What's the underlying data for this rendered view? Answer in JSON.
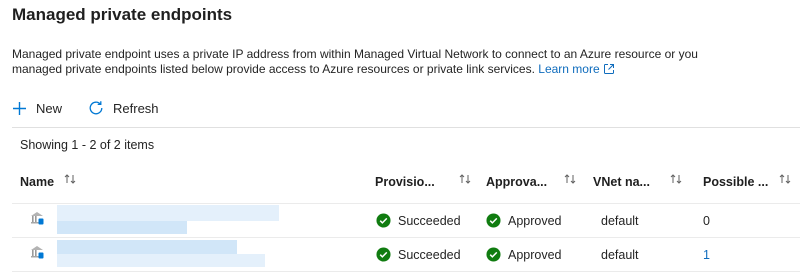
{
  "page": {
    "title": "Managed private endpoints",
    "description_line1": "Managed private endpoint uses a private IP address from within Managed Virtual Network to connect to an Azure resource or you",
    "description_line2": "managed private endpoints listed below provide access to Azure resources or private link services.",
    "learn_more": "Learn more"
  },
  "toolbar": {
    "new_label": "New",
    "refresh_label": "Refresh"
  },
  "list": {
    "count_text": "Showing 1 - 2 of 2 items",
    "columns": [
      {
        "label": "Name"
      },
      {
        "label": "Provisio..."
      },
      {
        "label": "Approva..."
      },
      {
        "label": "VNet na..."
      },
      {
        "label": "Possible ..."
      }
    ],
    "rows": [
      {
        "provisioning": "Succeeded",
        "approval": "Approved",
        "vnet": "default",
        "possible": "0"
      },
      {
        "provisioning": "Succeeded",
        "approval": "Approved",
        "vnet": "default",
        "possible": "1"
      }
    ]
  },
  "colors": {
    "link": "#0f6cbd",
    "success": "#107c10",
    "accent": "#0078d4"
  },
  "icons": {
    "new": "plus-icon",
    "refresh": "refresh-icon",
    "external": "external-link-icon",
    "sort": "sort-icon",
    "status": "checkmark-circle-icon",
    "resource": "private-endpoint-icon"
  }
}
